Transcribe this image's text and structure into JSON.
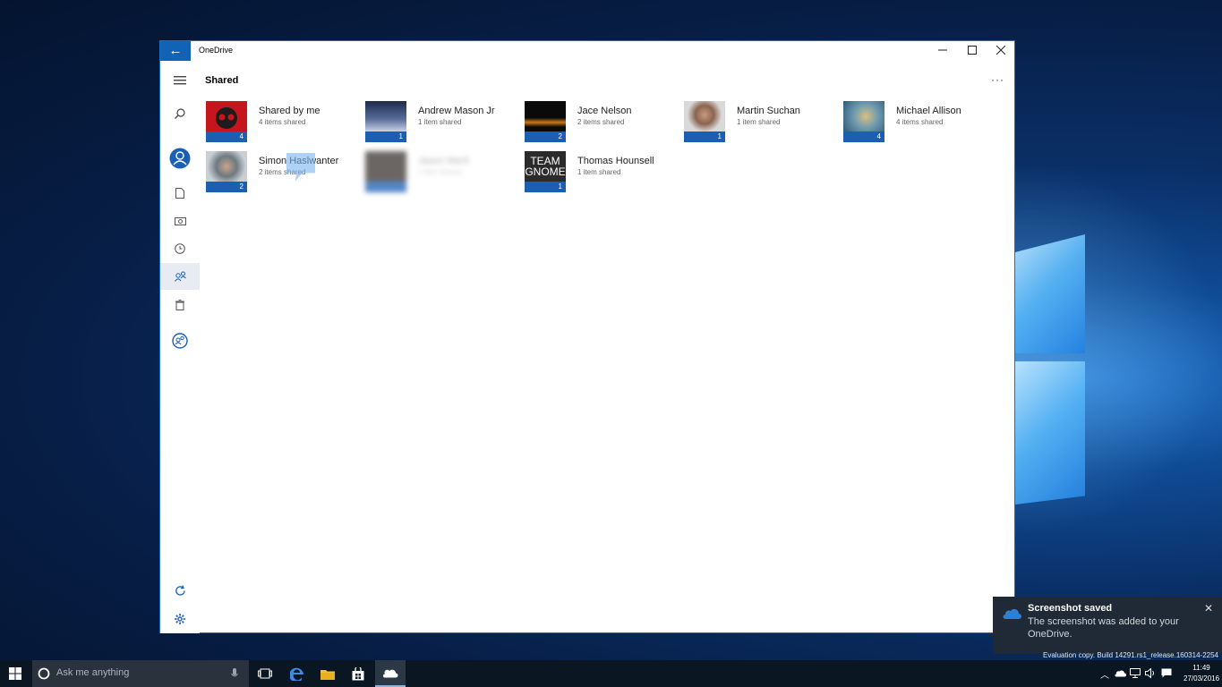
{
  "window": {
    "app_title": "OneDrive",
    "page_title": "Shared",
    "back_icon": "arrow-left-icon",
    "more_label": "···"
  },
  "rail": {
    "items": [
      "hamburger-icon",
      "search-icon",
      "account-icon",
      "files-icon",
      "photos-icon",
      "recent-icon",
      "shared-icon",
      "recycle-bin-icon",
      "people-icon",
      "refresh-icon",
      "settings-icon"
    ],
    "active": "shared-icon"
  },
  "people": [
    {
      "name": "Shared by me",
      "subtitle": "4 items shared",
      "count": "4",
      "color": "#c4161c"
    },
    {
      "name": "Andrew Mason Jr",
      "subtitle": "1 item shared",
      "count": "1",
      "color": "#3a4a6a"
    },
    {
      "name": "Jace Nelson",
      "subtitle": "2 items shared",
      "count": "2",
      "color": "#1c140c"
    },
    {
      "name": "Martin Suchan",
      "subtitle": "1 item shared",
      "count": "1",
      "color": "#8a6e58"
    },
    {
      "name": "Michael Allison",
      "subtitle": "4 items shared",
      "count": "4",
      "color": "#6e9ab0"
    },
    {
      "name": "Simon Haslwanter",
      "subtitle": "2 items shared",
      "count": "2",
      "color": "#5a6a72"
    },
    {
      "name": "Jason Merit",
      "subtitle": "1 item shared",
      "count": "",
      "color": "#3a3330"
    },
    {
      "name": "Thomas Hounsell",
      "subtitle": "1 item shared",
      "count": "1",
      "color": "#2b2b2b",
      "tile_text": "TEAM GNOME"
    }
  ],
  "toast": {
    "title": "Screenshot saved",
    "body": "The screenshot was added to your OneDrive."
  },
  "build_text": "Evaluation copy. Build 14291.rs1_release.160314-2254",
  "taskbar": {
    "search_placeholder": "Ask me anything",
    "time": "11:49",
    "date": "27/03/2016"
  },
  "colors": {
    "accent": "#1163b6",
    "count_bar": "#1a5fb4"
  }
}
